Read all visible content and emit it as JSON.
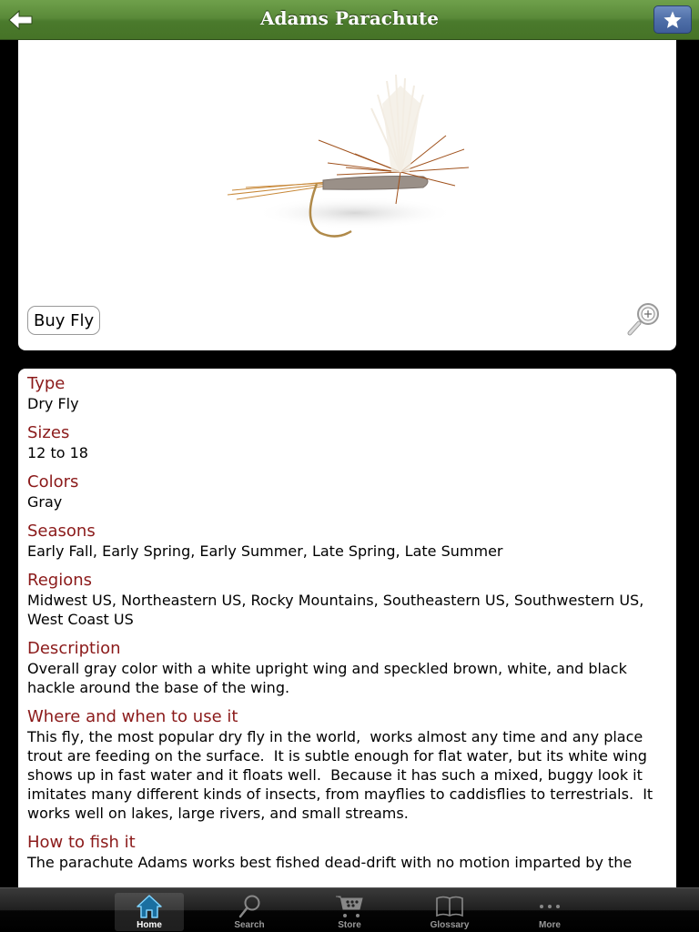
{
  "navbar": {
    "title": "Adams Parachute",
    "back_icon": "back-arrow-icon",
    "favorite_icon": "star-icon"
  },
  "image_card": {
    "image_alt": "Adams Parachute dry fly",
    "buy_label": "Buy Fly",
    "zoom_icon": "magnifier-plus-icon"
  },
  "details": [
    {
      "title": "Type",
      "body": "Dry Fly"
    },
    {
      "title": "Sizes",
      "body": "12 to 18"
    },
    {
      "title": "Colors",
      "body": "Gray"
    },
    {
      "title": "Seasons",
      "body": "Early Fall, Early Spring, Early Summer, Late Spring, Late Summer"
    },
    {
      "title": "Regions",
      "body": "Midwest US, Northeastern US, Rocky Mountains, Southeastern US, Southwestern US, West Coast US"
    },
    {
      "title": "Description",
      "body": "Overall gray color with a white upright wing and speckled brown, white, and black hackle around the base of the wing."
    },
    {
      "title": "Where and when to use it",
      "body": "This fly, the most popular dry fly in the world,  works almost any time and any place trout are feeding on the surface.  It is subtle enough for flat water, but its white wing shows up in fast water and it floats well.  Because it has such a mixed, buggy look it imitates many different kinds of insects, from mayflies to caddisflies to terrestrials.  It works well on lakes, large rivers, and small streams."
    },
    {
      "title": "How to fish it",
      "body": "The parachute Adams works best fished dead-drift with no motion imparted by the"
    }
  ],
  "tabbar": {
    "tabs": [
      {
        "label": "Home",
        "icon": "home-icon",
        "active": true
      },
      {
        "label": "Search",
        "icon": "search-icon",
        "active": false
      },
      {
        "label": "Store",
        "icon": "cart-icon",
        "active": false
      },
      {
        "label": "Glossary",
        "icon": "book-icon",
        "active": false
      },
      {
        "label": "More",
        "icon": "more-dots-icon",
        "active": false
      }
    ]
  },
  "colors": {
    "navbar_green": "#5a8a39",
    "favorite_blue": "#4f6fa8",
    "section_title": "#8b1a1a",
    "active_tab_icon": "#5bc0f0"
  }
}
